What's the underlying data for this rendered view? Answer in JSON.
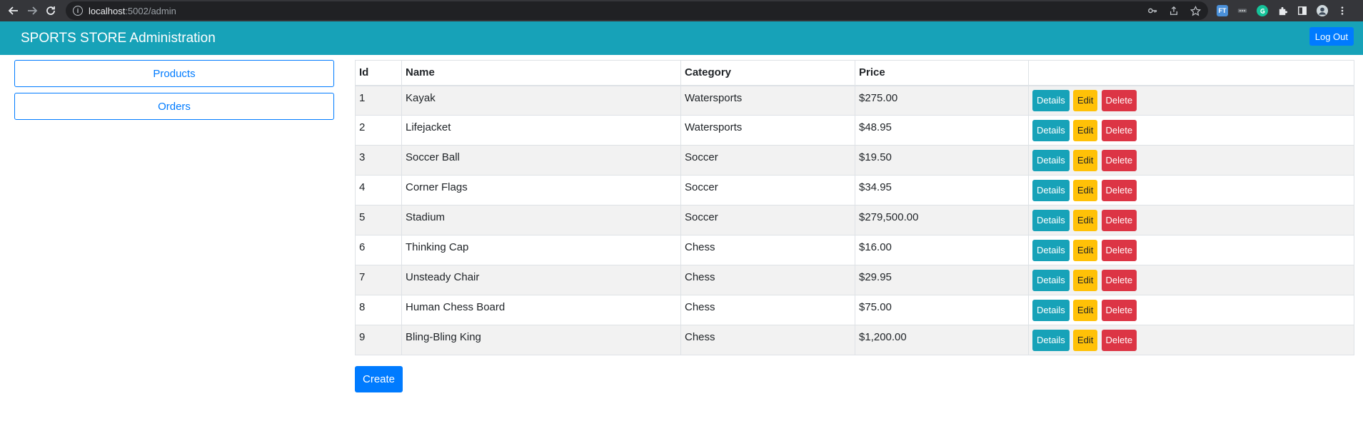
{
  "browser": {
    "url_host": "localhost",
    "url_path": ":5002/admin",
    "extension_label": "FT"
  },
  "header": {
    "title": "SPORTS STORE Administration",
    "logout_label": "Log Out"
  },
  "sidebar": {
    "items": [
      {
        "label": "Products"
      },
      {
        "label": "Orders"
      }
    ]
  },
  "table": {
    "headers": [
      "Id",
      "Name",
      "Category",
      "Price",
      ""
    ],
    "actions": {
      "details": "Details",
      "edit": "Edit",
      "delete": "Delete"
    },
    "rows": [
      {
        "id": "1",
        "name": "Kayak",
        "category": "Watersports",
        "price": "$275.00"
      },
      {
        "id": "2",
        "name": "Lifejacket",
        "category": "Watersports",
        "price": "$48.95"
      },
      {
        "id": "3",
        "name": "Soccer Ball",
        "category": "Soccer",
        "price": "$19.50"
      },
      {
        "id": "4",
        "name": "Corner Flags",
        "category": "Soccer",
        "price": "$34.95"
      },
      {
        "id": "5",
        "name": "Stadium",
        "category": "Soccer",
        "price": "$279,500.00"
      },
      {
        "id": "6",
        "name": "Thinking Cap",
        "category": "Chess",
        "price": "$16.00"
      },
      {
        "id": "7",
        "name": "Unsteady Chair",
        "category": "Chess",
        "price": "$29.95"
      },
      {
        "id": "8",
        "name": "Human Chess Board",
        "category": "Chess",
        "price": "$75.00"
      },
      {
        "id": "9",
        "name": "Bling-Bling King",
        "category": "Chess",
        "price": "$1,200.00"
      }
    ]
  },
  "create_label": "Create",
  "colors": {
    "header_bg": "#17a2b8",
    "primary": "#007bff",
    "info": "#17a2b8",
    "warning": "#ffc107",
    "danger": "#dc3545"
  }
}
